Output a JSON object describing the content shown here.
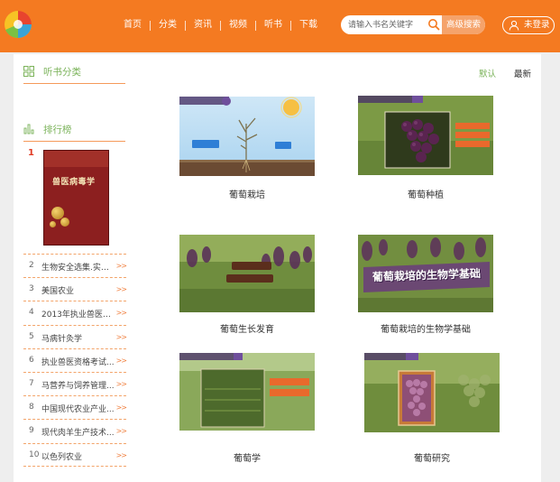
{
  "header": {
    "nav": [
      "首页",
      "分类",
      "资讯",
      "视频",
      "听书",
      "下载"
    ],
    "search_placeholder": "请输入书名关键字",
    "search_button": "高级搜索",
    "login_label": "未登录"
  },
  "colors": {
    "brand": "#f47a21",
    "accent_green": "#7bb35a",
    "rank_red": "#e03b24"
  },
  "sidebar": {
    "category_title": "听书分类",
    "ranking_title": "排行榜",
    "first": {
      "rank": "1",
      "cover_title": "兽医病毒学"
    },
    "items": [
      {
        "rank": "2",
        "title": "生物安全选集.实验..."
      },
      {
        "rank": "3",
        "title": "美国农业"
      },
      {
        "rank": "4",
        "title": "2013年执业兽医资..."
      },
      {
        "rank": "5",
        "title": "马病针灸学"
      },
      {
        "rank": "6",
        "title": "执业兽医资格考试..."
      },
      {
        "rank": "7",
        "title": "马营养与饲养管理..."
      },
      {
        "rank": "8",
        "title": "中国现代农业产业..."
      },
      {
        "rank": "9",
        "title": "现代肉羊生产技术..."
      },
      {
        "rank": "10",
        "title": "以色列农业"
      }
    ],
    "more_arrow": ">>"
  },
  "sort": {
    "default": "默认",
    "latest": "最新"
  },
  "cards": [
    {
      "caption": "葡萄栽培"
    },
    {
      "caption": "葡萄种植"
    },
    {
      "caption": "葡萄生长发育"
    },
    {
      "caption": "葡萄栽培的生物学基础",
      "overlay": "葡萄栽培的生物学基础"
    },
    {
      "caption": "葡萄学"
    },
    {
      "caption": "葡萄研究"
    }
  ]
}
